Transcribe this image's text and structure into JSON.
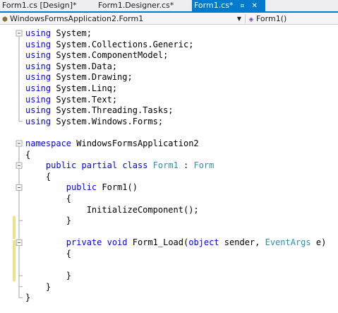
{
  "tabs": [
    {
      "label": "Form1.cs [Design]",
      "modified": "*",
      "active": false
    },
    {
      "label": "Form1.Designer.cs",
      "modified": "*",
      "active": false
    },
    {
      "label": "Form1.cs",
      "modified": "*",
      "active": true
    }
  ],
  "tab_icons": {
    "pin": "pin-icon",
    "close": "close-icon"
  },
  "navbar": {
    "class_selector": "WindowsFormsApplication2.Form1",
    "class_icon": "class-icon",
    "member_selector": "Form1()",
    "member_icon": "method-icon",
    "dropdown_icon": "dropdown-arrow-icon"
  },
  "colors": {
    "accent": "#007acc",
    "keyword": "#0000ff",
    "type": "#2b91af",
    "change_marker": "#efe08a",
    "outline": "#a5a5a5"
  },
  "code_lines": [
    [
      {
        "t": "using",
        "c": "kw"
      },
      {
        "t": " System;"
      }
    ],
    [
      {
        "t": "using",
        "c": "kw"
      },
      {
        "t": " System.Collections.Generic;"
      }
    ],
    [
      {
        "t": "using",
        "c": "kw"
      },
      {
        "t": " System.ComponentModel;"
      }
    ],
    [
      {
        "t": "using",
        "c": "kw"
      },
      {
        "t": " System.Data;"
      }
    ],
    [
      {
        "t": "using",
        "c": "kw"
      },
      {
        "t": " System.Drawing;"
      }
    ],
    [
      {
        "t": "using",
        "c": "kw"
      },
      {
        "t": " System.Linq;"
      }
    ],
    [
      {
        "t": "using",
        "c": "kw"
      },
      {
        "t": " System.Text;"
      }
    ],
    [
      {
        "t": "using",
        "c": "kw"
      },
      {
        "t": " System.Threading.Tasks;"
      }
    ],
    [
      {
        "t": "using",
        "c": "kw"
      },
      {
        "t": " System.Windows.Forms;"
      }
    ],
    [],
    [
      {
        "t": "namespace",
        "c": "kw"
      },
      {
        "t": " WindowsFormsApplication2"
      }
    ],
    [
      {
        "t": "{"
      }
    ],
    [
      {
        "t": "    "
      },
      {
        "t": "public",
        "c": "kw"
      },
      {
        "t": " "
      },
      {
        "t": "partial",
        "c": "kw"
      },
      {
        "t": " "
      },
      {
        "t": "class",
        "c": "kw"
      },
      {
        "t": " "
      },
      {
        "t": "Form1",
        "c": "ty"
      },
      {
        "t": " : "
      },
      {
        "t": "Form",
        "c": "ty"
      }
    ],
    [
      {
        "t": "    {"
      }
    ],
    [
      {
        "t": "        "
      },
      {
        "t": "public",
        "c": "kw"
      },
      {
        "t": " Form1()"
      }
    ],
    [
      {
        "t": "        {"
      }
    ],
    [
      {
        "t": "            InitializeComponent();"
      }
    ],
    [
      {
        "t": "        }"
      }
    ],
    [],
    [
      {
        "t": "        "
      },
      {
        "t": "private",
        "c": "kw"
      },
      {
        "t": " "
      },
      {
        "t": "void",
        "c": "kw"
      },
      {
        "t": " Form1_Load("
      },
      {
        "t": "object",
        "c": "kw"
      },
      {
        "t": " sender, "
      },
      {
        "t": "EventArgs",
        "c": "ty"
      },
      {
        "t": " e)"
      }
    ],
    [
      {
        "t": "        {"
      }
    ],
    [],
    [
      {
        "t": "        }"
      }
    ],
    [
      {
        "t": "    }"
      }
    ],
    [
      {
        "t": "}"
      }
    ]
  ]
}
